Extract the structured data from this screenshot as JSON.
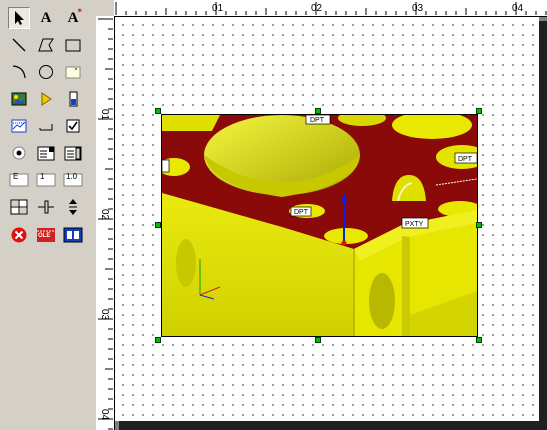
{
  "toolbox": {
    "text_tool_label": "A",
    "label_tool_label": "A",
    "edit_field_label": "E",
    "numeric_field_label": "1",
    "formatted_field_label": "1.0",
    "ole_label": "OLE"
  },
  "ruler": {
    "top_labels": [
      "01",
      "02",
      "03",
      "04"
    ],
    "left_labels": [
      "01",
      "02",
      "03",
      "04"
    ]
  },
  "picture": {
    "tags": [
      "DPT",
      "DPT",
      "DPT",
      "PXTY"
    ]
  },
  "colors": {
    "model_yellow": "#e8e800",
    "model_red": "#8a0a0a",
    "handle": "#00c000"
  }
}
